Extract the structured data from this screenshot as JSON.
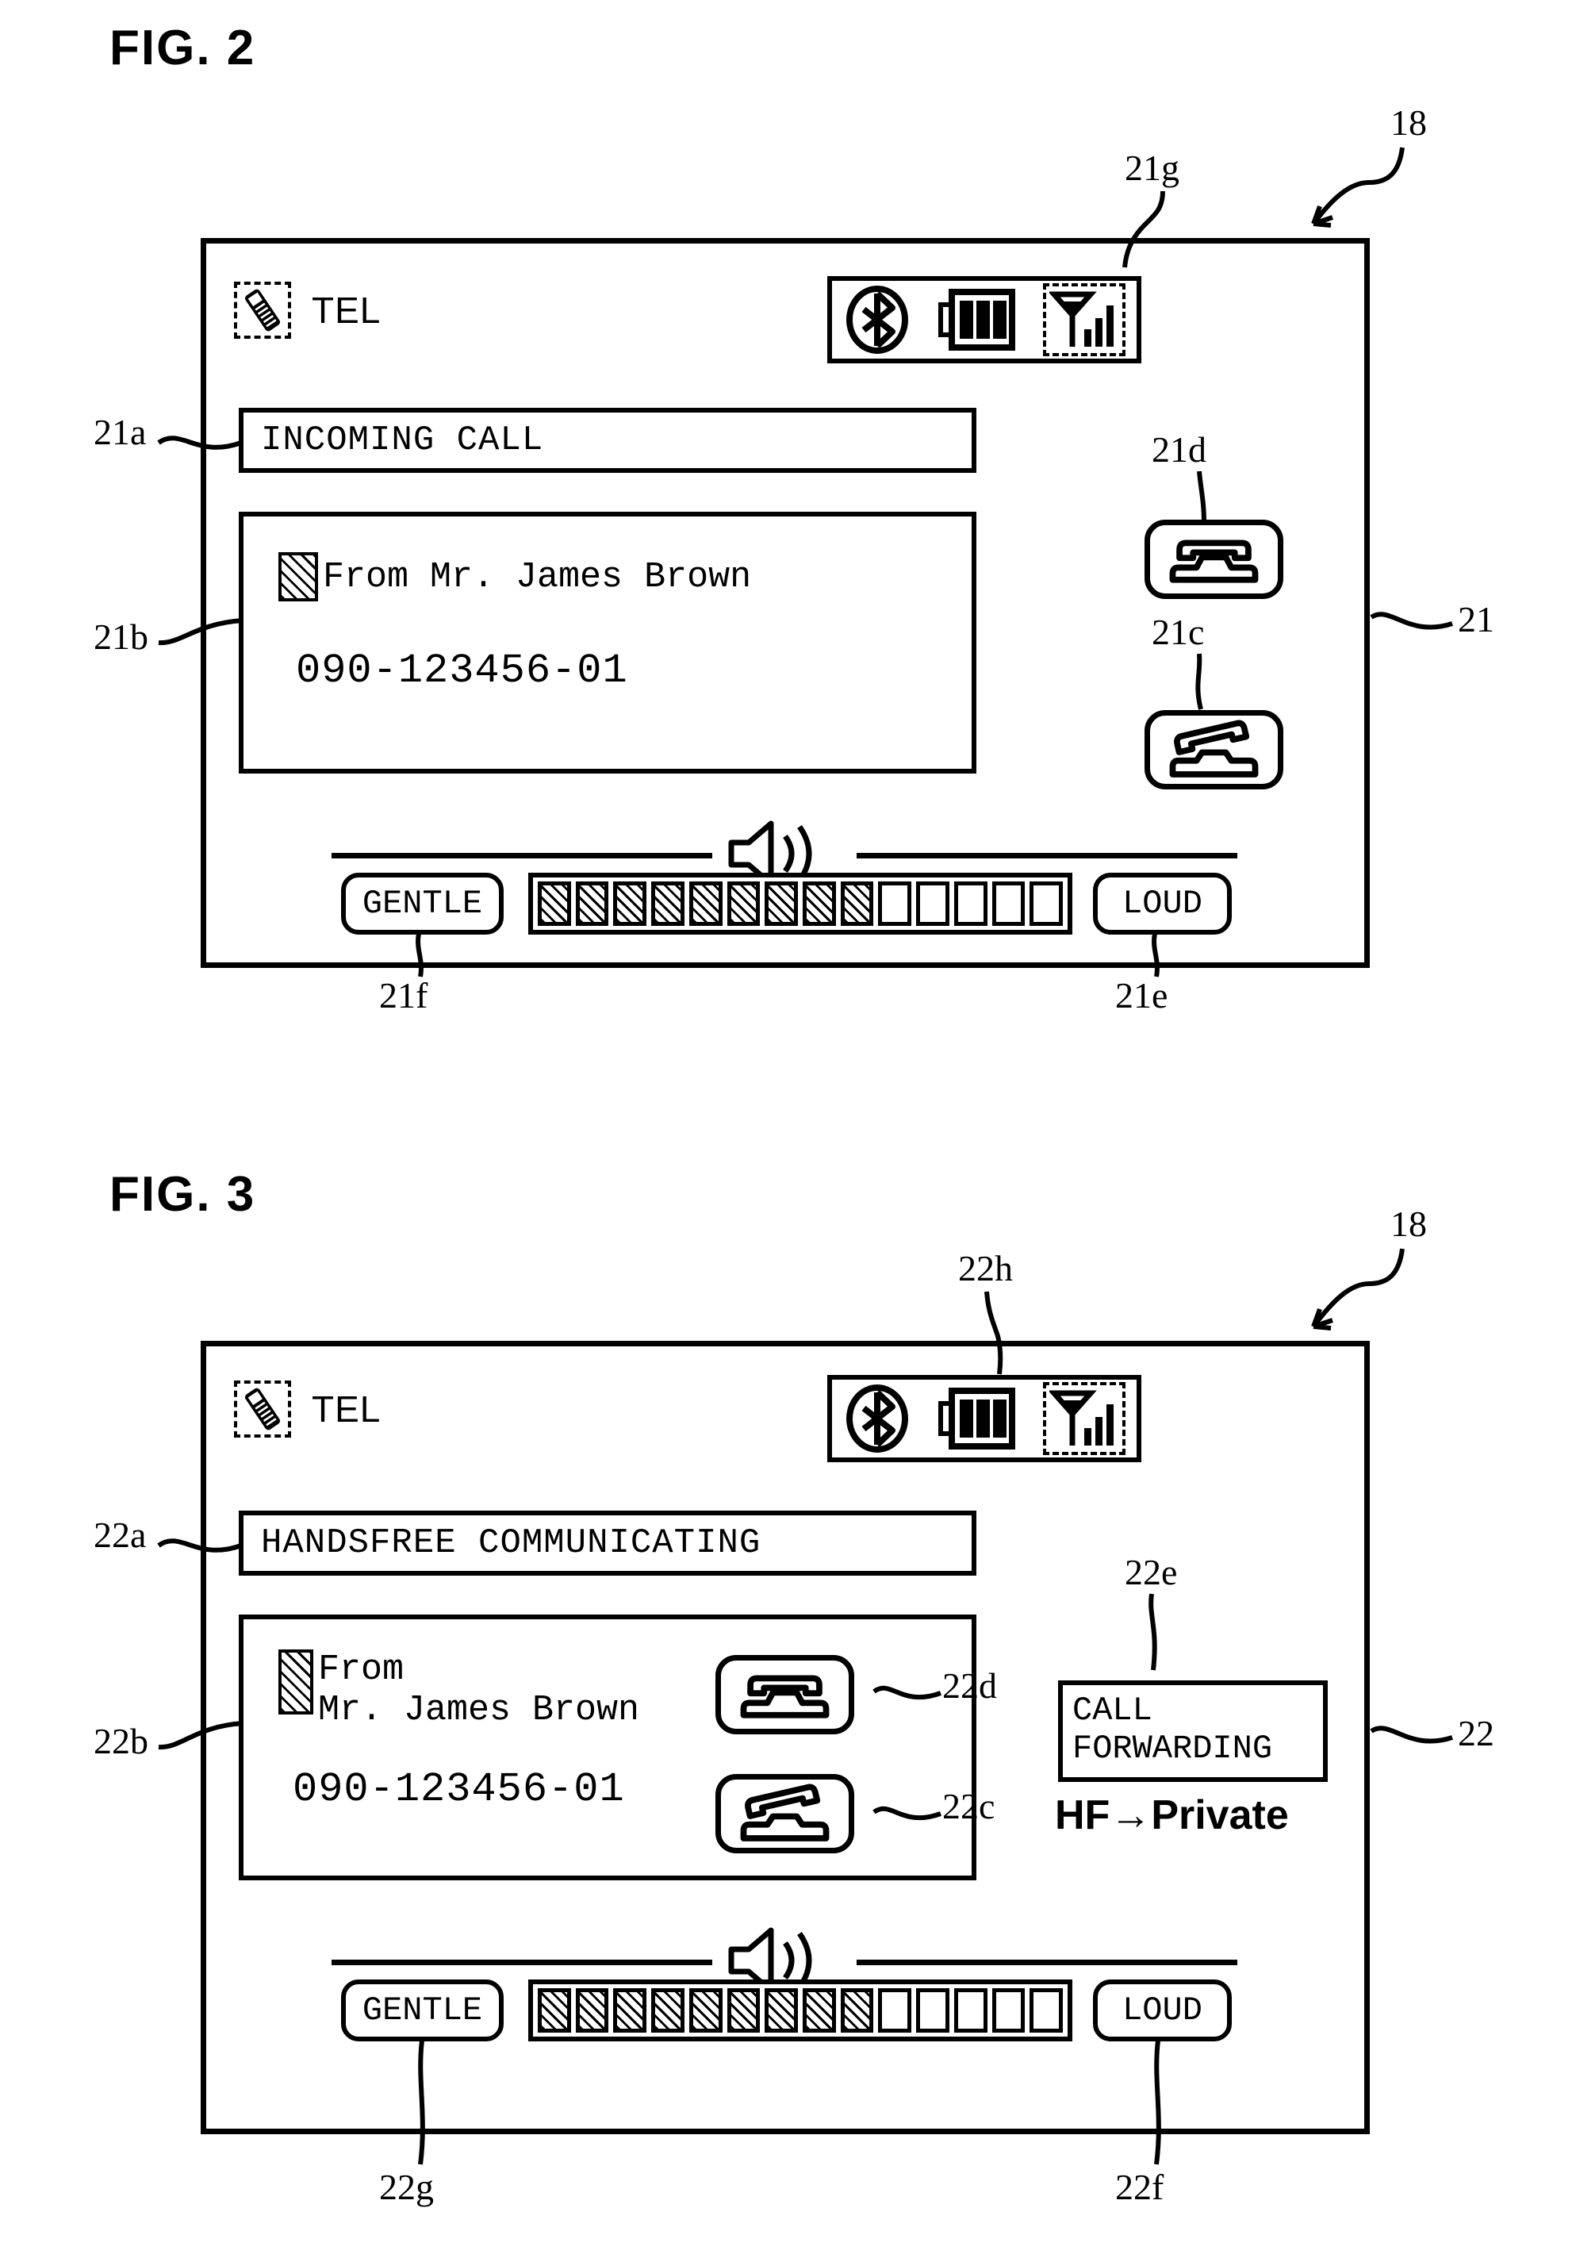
{
  "figures": [
    {
      "id": "fig2",
      "title": "FIG. 2",
      "screen_ref": "18",
      "panel_ref": "21",
      "header": {
        "tel_label": "TEL",
        "tel_icon": "mobile-phone-icon",
        "status_icons": [
          "bluetooth-icon",
          "battery-icon",
          "signal-strength-icon"
        ],
        "status_ref": "21g"
      },
      "title_bar": {
        "text": "INCOMING CALL",
        "ref": "21a"
      },
      "info_panel": {
        "ref": "21b",
        "from_line": "From Mr. James Brown",
        "number": "090-123456-01",
        "badge": "hatched-square-icon"
      },
      "buttons": [
        {
          "ref": "21d",
          "icon": "telephone-on-hook-icon",
          "name": "answer-call-button"
        },
        {
          "ref": "21c",
          "icon": "telephone-off-hook-icon",
          "name": "end-call-button"
        }
      ],
      "volume": {
        "icon": "speaker-icon",
        "gentle_label": "GENTLE",
        "gentle_ref": "21f",
        "loud_label": "LOUD",
        "loud_ref": "21e",
        "segments_total": 14,
        "segments_filled": 9
      }
    },
    {
      "id": "fig3",
      "title": "FIG. 3",
      "screen_ref": "18",
      "panel_ref": "22",
      "header": {
        "tel_label": "TEL",
        "tel_icon": "mobile-phone-icon",
        "status_icons": [
          "bluetooth-icon",
          "battery-icon",
          "signal-strength-icon"
        ],
        "status_ref": "22h"
      },
      "title_bar": {
        "text": "HANDSFREE COMMUNICATING",
        "ref": "22a"
      },
      "info_panel": {
        "ref": "22b",
        "from_line_1": "From",
        "from_line_2": "Mr. James Brown",
        "number": "090-123456-01",
        "badge": "hatched-square-icon"
      },
      "buttons": [
        {
          "ref": "22d",
          "icon": "telephone-on-hook-icon",
          "name": "answer-call-button"
        },
        {
          "ref": "22c",
          "icon": "telephone-off-hook-icon",
          "name": "end-call-button"
        }
      ],
      "call_forwarding": {
        "ref": "22e",
        "line_1": "CALL",
        "line_2": "FORWARDING",
        "transfer_text": "HF→Private"
      },
      "volume": {
        "icon": "speaker-icon",
        "gentle_label": "GENTLE",
        "gentle_ref": "22g",
        "loud_label": "LOUD",
        "loud_ref": "22f",
        "segments_total": 14,
        "segments_filled": 9
      }
    }
  ],
  "colors": {
    "ink": "#000000",
    "paper": "#ffffff"
  }
}
